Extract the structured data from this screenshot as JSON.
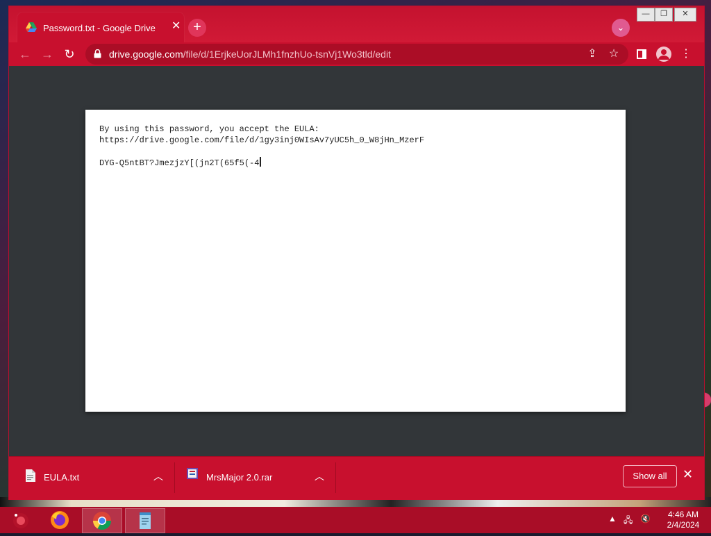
{
  "colors": {
    "chrome_red": "#c8102e",
    "viewer_bg": "#323639",
    "page_bg": "#ffffff",
    "text_dark": "#222222"
  },
  "window_controls": {
    "minimize": "—",
    "restore": "❐",
    "close": "✕"
  },
  "tab": {
    "title": "Password.txt - Google Drive",
    "favicon": "google-drive-icon",
    "close_glyph": "✕"
  },
  "new_tab_glyph": "+",
  "tab_search_glyph": "⌄",
  "toolbar": {
    "back": "←",
    "forward": "→",
    "reload": "↻",
    "url_host": "drive.google.com",
    "url_path": "/file/d/1ErjkeUorJLMh1fnzhUo-tsnVj1Wo3tld/edit",
    "share_glyph": "⇪",
    "star_glyph": "☆",
    "menu_glyph": "⋮"
  },
  "document": {
    "line1": "By using this password, you accept the EULA:",
    "line2": "https://drive.google.com/file/d/1gy3inj0WIsAv7yUC5h_0_W8jHn_MzerF",
    "line3": "",
    "line4": "DYG-Q5ntBT?JmezjzY[(jn2T(65f5(-4"
  },
  "downloads": {
    "items": [
      {
        "name": "EULA.txt",
        "icon": "text-file-icon"
      },
      {
        "name": "MrsMajor 2.0.rar",
        "icon": "rar-archive-icon"
      }
    ],
    "show_all_label": "Show all",
    "close_glyph": "✕",
    "chevron_glyph": "︿"
  },
  "taskbar": {
    "apps": [
      "ruby-installer-icon",
      "firefox-icon",
      "chrome-icon",
      "notepad-icon"
    ],
    "time": "4:46 AM",
    "date": "2/4/2024"
  }
}
